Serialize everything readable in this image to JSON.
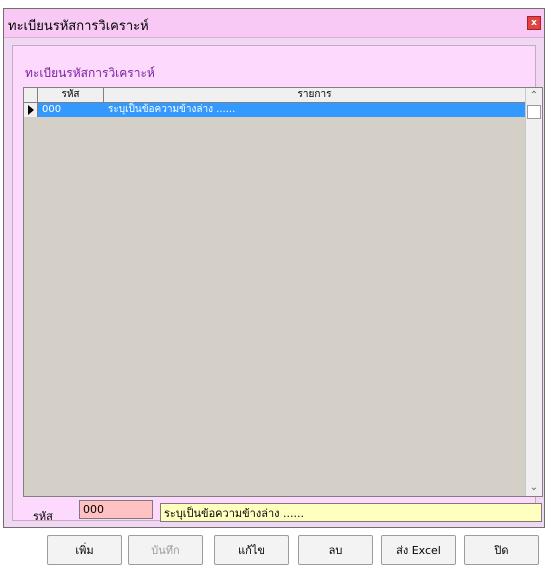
{
  "window": {
    "title": "ทะเบียนรหัสการวิเคราะห์",
    "close_label": "x"
  },
  "form": {
    "caption": "ทะเบียนรหัสการวิเคราะห์"
  },
  "grid": {
    "columns": [
      "รหัส",
      "รายการ"
    ],
    "rows": [
      {
        "code": "000",
        "item": "ระบุเป็นข้อความข้างล่าง ......",
        "selected": true
      }
    ]
  },
  "editor": {
    "code_label": "รหัส",
    "code_value": "000",
    "desc_value": "ระบุเป็นข้อความข้างล่าง ......"
  },
  "buttons": {
    "add": "เพิ่ม",
    "save": "บันทึก",
    "edit": "แก้ไข",
    "delete": "ลบ",
    "export": "ส่ง Excel",
    "close": "ปิด"
  },
  "colors": {
    "titlebar": "#f7c9f4",
    "form_bg": "#fdd9fd",
    "grid_bg": "#d4d0c8",
    "selection": "#3399ff",
    "code_field": "#ffc1c1",
    "desc_field": "#ffffc0",
    "caption": "#7a1fa0"
  },
  "icons": {
    "scroll_up": "chevron-up-icon",
    "scroll_down": "chevron-down-icon",
    "row_indicator": "triangle-right-icon"
  }
}
